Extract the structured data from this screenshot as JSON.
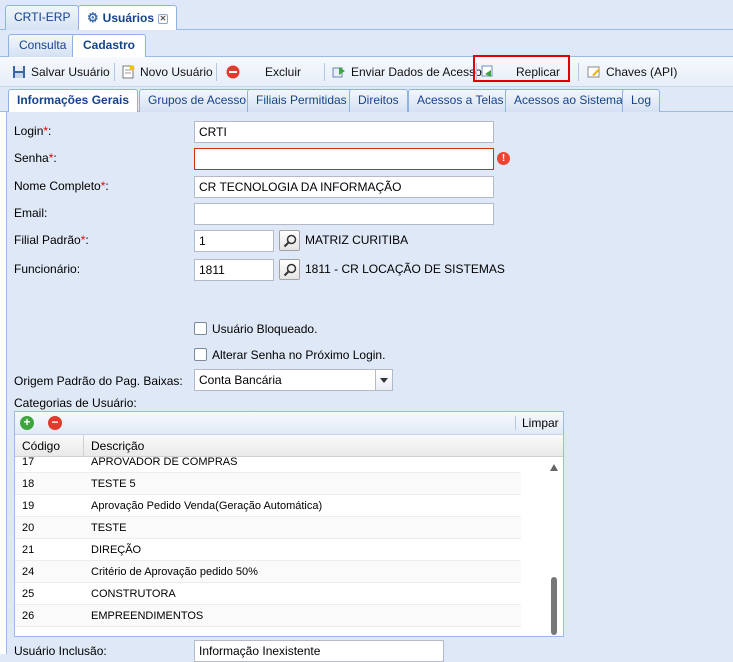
{
  "window_tabs": [
    {
      "label": "CRTI-ERP"
    },
    {
      "label": "Usuários"
    }
  ],
  "sub_tabs": [
    {
      "label": "Consulta"
    },
    {
      "label": "Cadastro"
    }
  ],
  "toolbar": {
    "salvar": "Salvar Usuário",
    "novo": "Novo Usuário",
    "excluir": "Excluir",
    "enviar": "Enviar Dados de Acesso",
    "replicar": "Replicar",
    "chaves": "Chaves (API)"
  },
  "inner_tabs": [
    {
      "label": "Informações Gerais"
    },
    {
      "label": "Grupos de Acesso"
    },
    {
      "label": "Filiais Permitidas"
    },
    {
      "label": "Direitos"
    },
    {
      "label": "Acessos a Telas"
    },
    {
      "label": "Acessos ao Sistema"
    },
    {
      "label": "Log"
    }
  ],
  "form": {
    "login_label": "Login",
    "login_value": "CRTI",
    "senha_label": "Senha",
    "senha_value": "",
    "nome_label": "Nome Completo",
    "nome_value": "CR TECNOLOGIA DA INFORMAÇÃO",
    "email_label": "Email",
    "email_value": "",
    "filial_label": "Filial Padrão",
    "filial_value": "1",
    "filial_desc": "MATRIZ CURITIBA",
    "func_label": "Funcionário:",
    "func_value": "1811",
    "func_desc": "1811 - CR LOCAÇÃO DE SISTEMAS",
    "bloqueado_label": "Usuário Bloqueado.",
    "alterar_label": "Alterar Senha no Próximo Login.",
    "origem_label": "Origem Padrão do Pag. Baixas:",
    "origem_value": "Conta Bancária",
    "categorias_label": "Categorias de Usuário:",
    "inclusao_label": "Usuário Inclusão:",
    "inclusao_value": "Informação Inexistente",
    "required_mark": "*",
    "colon": ":"
  },
  "grid": {
    "limpar": "Limpar",
    "col_codigo": "Código",
    "col_descricao": "Descrição",
    "rows": [
      {
        "codigo": "17",
        "descricao": "APROVADOR DE COMPRAS"
      },
      {
        "codigo": "18",
        "descricao": "TESTE 5"
      },
      {
        "codigo": "19",
        "descricao": "Aprovação Pedido Venda(Geração Automática)"
      },
      {
        "codigo": "20",
        "descricao": "TESTE"
      },
      {
        "codigo": "21",
        "descricao": "DIREÇÃO"
      },
      {
        "codigo": "24",
        "descricao": "Critério de Aprovação pedido 50%"
      },
      {
        "codigo": "25",
        "descricao": "CONSTRUTORA"
      },
      {
        "codigo": "26",
        "descricao": "EMPREENDIMENTOS"
      }
    ]
  },
  "colors": {
    "accent": "#15428b",
    "panel_bg": "#dfe8f6",
    "highlight": "#e00000",
    "required": "#ee0000"
  }
}
